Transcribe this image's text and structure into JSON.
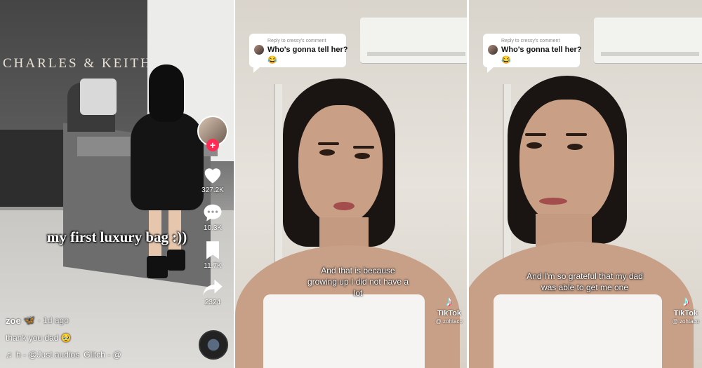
{
  "panel1": {
    "store_sign": "CHARLES & KEITH",
    "caption": "my first luxury bag :))",
    "actions": {
      "likes": "327.2K",
      "comments": "10.3K",
      "saves": "11.7K",
      "shares": "2324"
    },
    "username": "zoe",
    "username_emoji": "🦋",
    "time_ago": "· 1d ago",
    "description": "thank you dad 🥹",
    "music_note": "♫",
    "music_text": "h - @Just audios",
    "music_text2": "Glitch - @"
  },
  "panel2": {
    "reply_label": "Reply to cressy's comment",
    "reply_text": "Who's gonna tell her?",
    "reply_emoji": "😂",
    "subtitle": "And that is because growing up I did not have a lot",
    "brand": "TikTok",
    "handle": "@ zohtaco"
  },
  "panel3": {
    "reply_label": "Reply to cressy's comment",
    "reply_text": "Who's gonna tell her?",
    "reply_emoji": "😂",
    "subtitle": "And I'm so grateful that my dad was able to get me one",
    "brand": "TikTok",
    "handle": "@ zohtaco"
  },
  "colors": {
    "tiktok_red": "#fe2c55",
    "tiktok_cyan": "#25f4ee"
  }
}
